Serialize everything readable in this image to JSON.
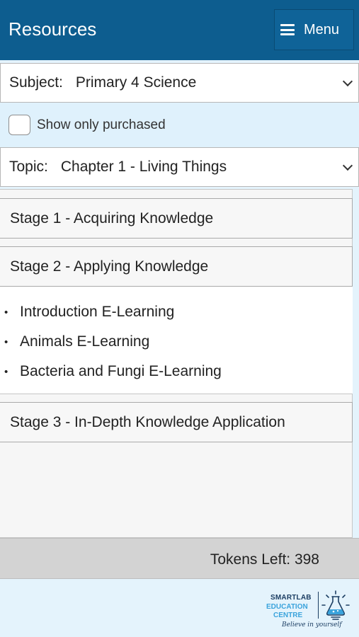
{
  "header": {
    "title": "Resources",
    "menu_label": "Menu"
  },
  "subject": {
    "label": "Subject:",
    "value": "Primary 4 Science"
  },
  "filter": {
    "label": "Show only purchased",
    "checked": false
  },
  "topic": {
    "label": "Topic:",
    "value": "Chapter 1 - Living Things"
  },
  "stages": [
    {
      "label": "Stage 1 - Acquiring Knowledge"
    },
    {
      "label": "Stage 2 - Applying Knowledge",
      "items": [
        "Introduction E-Learning",
        "Animals E-Learning",
        "Bacteria and Fungi E-Learning"
      ]
    },
    {
      "label": "Stage 3 - In-Depth Knowledge Application"
    }
  ],
  "tokens": {
    "label": "Tokens Left:",
    "value": "398"
  },
  "logo": {
    "line1": "SMARTLAB",
    "line2": "EDUCATION",
    "line3": "CENTRE",
    "tagline": "Believe in yourself"
  },
  "colors": {
    "header": "#0d5d8f",
    "background": "#e4f3fc",
    "token_bar": "#d3d3d3",
    "logo_dark": "#1c3e63",
    "logo_light": "#3aa3dc"
  },
  "icons": {
    "menu": "hamburger-icon",
    "dropdown": "chevron-down-icon",
    "logo": "flask-lightbulb-icon"
  }
}
